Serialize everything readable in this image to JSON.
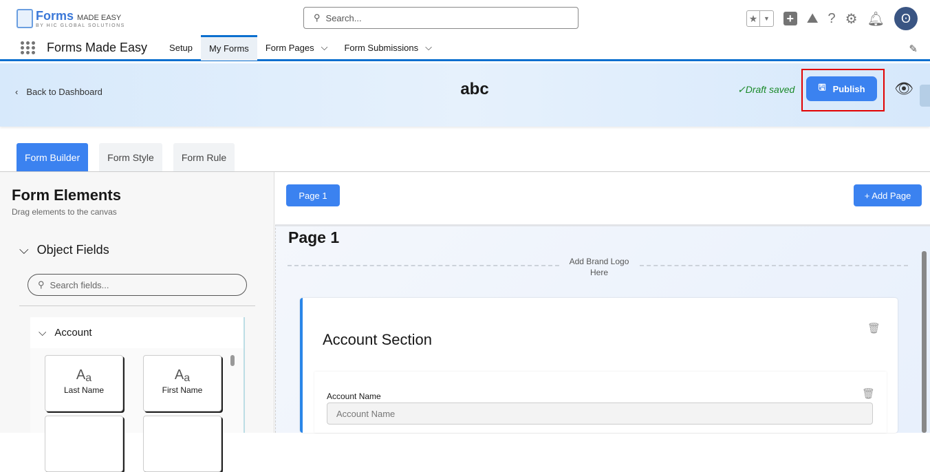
{
  "topbar": {
    "logo_main": "Forms",
    "logo_suffix": "MADE EASY",
    "logo_tagline": "BY HIC GLOBAL SOLUTIONS",
    "search_placeholder": "Search..."
  },
  "nav": {
    "app_name": "Forms Made Easy",
    "tabs": [
      {
        "label": "Setup"
      },
      {
        "label": "My Forms"
      },
      {
        "label": "Form Pages"
      },
      {
        "label": "Form Submissions"
      }
    ]
  },
  "header": {
    "back": "Back to Dashboard",
    "title": "abc",
    "draft_status": "Draft saved",
    "publish": "Publish"
  },
  "builder_tabs": [
    "Form Builder",
    "Form Style",
    "Form Rule"
  ],
  "left": {
    "title": "Form Elements",
    "subtitle": "Drag elements to the canvas",
    "object_fields": "Object Fields",
    "search_placeholder": "Search fields...",
    "group": "Account",
    "fields": [
      "Last Name",
      "First Name"
    ],
    "field_icon": "Aa"
  },
  "canvas": {
    "page_tab": "Page 1",
    "add_page": "+ Add Page",
    "page_title": "Page 1",
    "brand_logo": "Add Brand Logo Here",
    "section_title": "Account Section",
    "field_label": "Account Name",
    "field_placeholder": "Account Name"
  }
}
